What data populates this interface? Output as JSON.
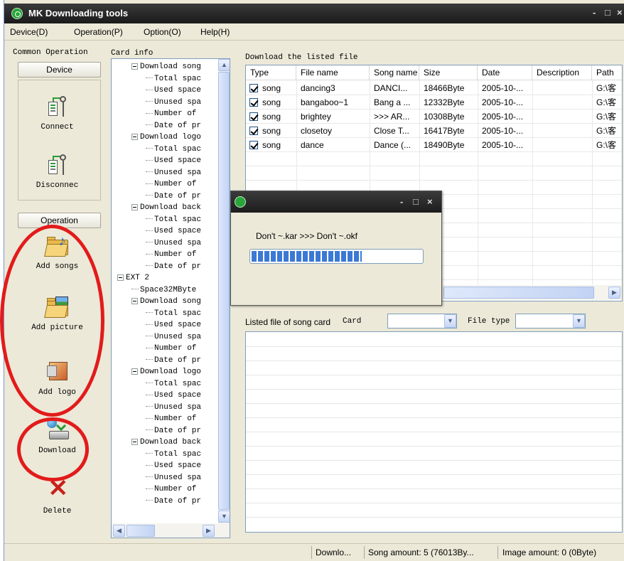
{
  "window": {
    "title": "MK Downloading tools",
    "controls": [
      "-",
      "□",
      "×"
    ]
  },
  "menu": [
    "Device(D)",
    "Operation(P)",
    "Option(O)",
    "Help(H)"
  ],
  "sidebar": {
    "common_heading": "Common Operation",
    "device_button": "Device",
    "connect": "Connect",
    "disconnect": "Disconnec",
    "operation_button": "Operation",
    "add_songs": "Add songs",
    "add_picture": "Add picture",
    "add_logo": "Add logo",
    "download": "Download",
    "delete": "Delete"
  },
  "card_info": {
    "label": "Card info",
    "tree": [
      "Download song",
      "Total spac",
      "Used space",
      "Unused spa",
      "Number of",
      "Date of pr",
      "Download logo",
      "Total spac",
      "Used space",
      "Unused spa",
      "Number of",
      "Date of pr",
      "Download back",
      "Total spac",
      "Used space",
      "Unused spa",
      "Number of",
      "Date of pr",
      "EXT 2",
      "Space32MByte",
      "Download song",
      "Total spac",
      "Used space",
      "Unused spa",
      "Number of",
      "Date of pr",
      "Download logo",
      "Total spac",
      "Used space",
      "Unused spa",
      "Number of",
      "Date of pr",
      "Download back",
      "Total spac",
      "Used space",
      "Unused spa",
      "Number of",
      "Date of pr"
    ]
  },
  "download_list": {
    "label": "Download the listed file",
    "columns": [
      "Type",
      "File name",
      "Song name",
      "Size",
      "Date",
      "Description",
      "Path"
    ],
    "rows": [
      {
        "type": "song",
        "file": "dancing3",
        "song": "DANCI...",
        "size": "18466Byte",
        "date": "2005-10-...",
        "desc": "",
        "path": "G:\\客"
      },
      {
        "type": "song",
        "file": "bangaboo~1",
        "song": "Bang a ...",
        "size": "12332Byte",
        "date": "2005-10-...",
        "desc": "",
        "path": "G:\\客"
      },
      {
        "type": "song",
        "file": "brightey",
        "song": ">>> AR...",
        "size": "10308Byte",
        "date": "2005-10-...",
        "desc": "",
        "path": "G:\\客"
      },
      {
        "type": "song",
        "file": "closetoy",
        "song": "Close T...",
        "size": "16417Byte",
        "date": "2005-10-...",
        "desc": "",
        "path": "G:\\客"
      },
      {
        "type": "song",
        "file": "dance",
        "song": "Dance (...",
        "size": "18490Byte",
        "date": "2005-10-...",
        "desc": "",
        "path": "G:\\客"
      }
    ]
  },
  "progress_dialog": {
    "text": "Don't ~.kar >>> Don't ~.okf",
    "progress": 0.65,
    "controls": [
      "-",
      "□",
      "×"
    ]
  },
  "song_card": {
    "label": "Listed file of song card",
    "card_label": "Card",
    "card_value": "",
    "file_type_label": "File type",
    "file_type_value": ""
  },
  "status": {
    "mode": "Downlo...",
    "song_amount": "Song amount: 5 (76013By...",
    "image_amount": "Image amount: 0 (0Byte)"
  },
  "colors": {
    "annotation": "#e21b1b",
    "accent": "#3c79d4"
  }
}
